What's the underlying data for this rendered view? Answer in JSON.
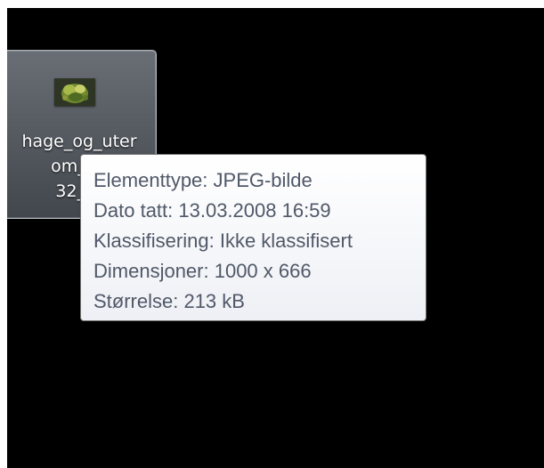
{
  "desktop": {
    "selected_file": {
      "icon": "jpeg-thumbnail-icon",
      "name_lines": [
        "hage_og_uter",
        "om_12",
        "32_th"
      ]
    },
    "tooltip": {
      "lines": [
        "Elementtype: JPEG-bilde",
        "Dato tatt: 13.03.2008 16:59",
        "Klassifisering: Ikke klassifisert",
        "Dimensjoner: 1000 x 666",
        "Størrelse: 213 kB"
      ]
    }
  },
  "colors": {
    "desktop_background": "#000000",
    "selection_fill": "#8a929e",
    "tooltip_text": "#505868",
    "tooltip_border": "#767676"
  }
}
